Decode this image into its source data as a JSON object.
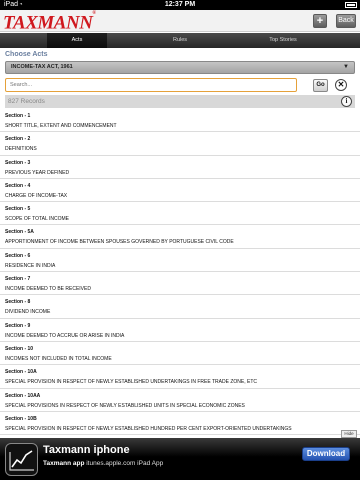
{
  "status_bar": {
    "carrier": "iPad",
    "time": "12:37 PM"
  },
  "header": {
    "logo": "TAXMANN",
    "logo_mark": "®",
    "plus_label": "+",
    "back_label": "Back"
  },
  "tabs": [
    {
      "label": "Acts",
      "active": true
    },
    {
      "label": "Rules",
      "active": false
    },
    {
      "label": "Top Stories",
      "active": false
    }
  ],
  "acts": {
    "choose_label": "Choose Acts",
    "selected_act": "INCOME-TAX ACT, 1961"
  },
  "search": {
    "placeholder": "Search...",
    "go_label": "Go",
    "clear_label": "✕"
  },
  "records": {
    "count_text": "827 Records",
    "info_label": "i"
  },
  "sections": [
    {
      "number": "Section - 1",
      "title": "SHORT TITLE, EXTENT AND COMMENCEMENT"
    },
    {
      "number": "Section - 2",
      "title": "DEFINITIONS"
    },
    {
      "number": "Section - 3",
      "title": "PREVIOUS YEAR DEFINED"
    },
    {
      "number": "Section - 4",
      "title": "CHARGE OF INCOME-TAX"
    },
    {
      "number": "Section - 5",
      "title": "SCOPE OF TOTAL INCOME"
    },
    {
      "number": "Section - 5A",
      "title": "APPORTIONMENT OF INCOME BETWEEN SPOUSES GOVERNED BY PORTUGUESE CIVIL CODE"
    },
    {
      "number": "Section - 6",
      "title": "RESIDENCE IN INDIA"
    },
    {
      "number": "Section - 7",
      "title": "INCOME DEEMED TO BE RECEIVED"
    },
    {
      "number": "Section - 8",
      "title": "DIVIDEND INCOME"
    },
    {
      "number": "Section - 9",
      "title": "INCOME DEEMED TO ACCRUE OR ARISE IN INDIA"
    },
    {
      "number": "Section - 10",
      "title": "INCOMES NOT INCLUDED IN TOTAL INCOME"
    },
    {
      "number": "Section - 10A",
      "title": "SPECIAL PROVISION IN RESPECT OF NEWLY ESTABLISHED UNDERTAKINGS IN FREE TRADE ZONE, ETC"
    },
    {
      "number": "Section - 10AA",
      "title": "SPECIAL PROVISIONS IN RESPECT OF NEWLY ESTABLISHED UNITS IN SPECIAL ECONOMIC ZONES"
    },
    {
      "number": "Section - 10B",
      "title": "SPECIAL PROVISION IN RESPECT OF NEWLY ESTABLISHED HUNDRED PER CENT EXPORT-ORIENTED UNDERTAKINGS"
    }
  ],
  "hide_label": "Hide",
  "ad": {
    "title": "Taxmann iphone",
    "app_name": "Taxmann app",
    "source": "itunes.apple.com iPad App",
    "download_label": "Download"
  },
  "colors": {
    "brand_red": "#d0181e",
    "section_header": "#6a7f9f",
    "search_border": "#e5a13a",
    "download_blue": "#2453b1"
  }
}
